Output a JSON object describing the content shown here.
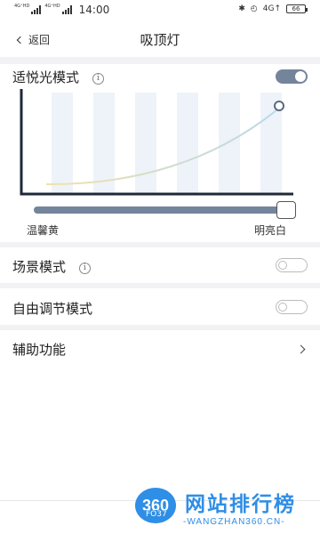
{
  "status_bar": {
    "signal1_label": "4G⁺HD",
    "signal2_label": "4G⁺HD",
    "time": "14:00",
    "network_label": "4G↑",
    "battery": "66"
  },
  "header": {
    "back_label": "返回",
    "title": "吸顶灯"
  },
  "circadian": {
    "label": "适悦光模式",
    "info_symbol": "i",
    "enabled": true,
    "slider_value": 1.0,
    "slider_left_label": "温馨黄",
    "slider_right_label": "明亮白"
  },
  "scene_mode": {
    "label": "场景模式",
    "info_symbol": "i",
    "enabled": false
  },
  "free_mode": {
    "label": "自由调节模式",
    "enabled": false
  },
  "assist": {
    "label": "辅助功能"
  },
  "watermark": {
    "logo_text": "360",
    "tag_text": "FO37",
    "title": "网站排行榜",
    "subtitle": "-WANGZHAN360.CN-"
  },
  "colors": {
    "toggle_on": "#74849b",
    "chart_bar": "#eef3f9",
    "curve_start": "#f0e2a8",
    "curve_end": "#b8d8ec",
    "watermark_blue": "#2f8ee6"
  },
  "icons": {
    "back": "chevron-left-icon",
    "info": "info-icon",
    "forward": "chevron-right-icon",
    "bluetooth": "bluetooth-icon",
    "alarm": "alarm-icon"
  }
}
